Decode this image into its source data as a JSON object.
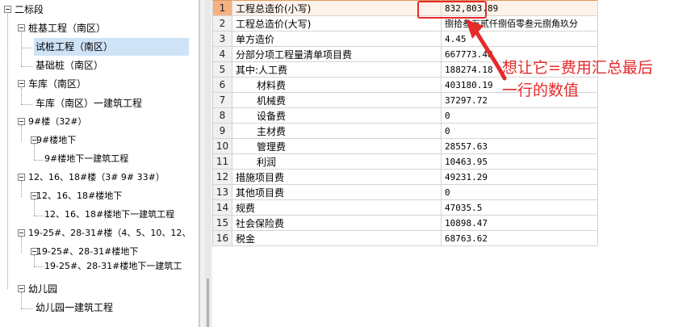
{
  "tree": {
    "items": [
      {
        "label": "二标段"
      },
      {
        "label": "桩基工程（南区）"
      },
      {
        "label": "试桩工程（南区）"
      },
      {
        "label": "基础桩（南区）"
      },
      {
        "label": "车库（南区）"
      },
      {
        "label": "车库（南区）一建筑工程"
      },
      {
        "label": "9#楼（32#）"
      },
      {
        "label": "9#楼地下"
      },
      {
        "label": "9#楼地下一建筑工程"
      },
      {
        "label": "12、16、18#楼（3# 9# 33#）"
      },
      {
        "label": "12、16、18#楼地下"
      },
      {
        "label": "12、16、18#楼地下一建筑工程"
      },
      {
        "label": "19-25#、28-31#楼（4、5、10、12、"
      },
      {
        "label": "19-25#、28-31#楼地下"
      },
      {
        "label": "19-25#、28-31#楼地下一建筑工"
      },
      {
        "label": "幼儿园"
      },
      {
        "label": "幼儿园一建筑工程"
      }
    ]
  },
  "grid": {
    "rows": [
      {
        "no": "1",
        "name": "工程总造价(小写)",
        "value": "832,803.89"
      },
      {
        "no": "2",
        "name": "工程总造价(大写)",
        "value": "捌拾叁万贰仟捌佰零叁元捌角玖分"
      },
      {
        "no": "3",
        "name": "单方造价",
        "value": "4.45"
      },
      {
        "no": "4",
        "name": "分部分项工程量清单项目费",
        "value": "667773.48"
      },
      {
        "no": "5",
        "name": "其中:人工费",
        "value": "188274.18"
      },
      {
        "no": "6",
        "name": "材料费",
        "value": "403180.19"
      },
      {
        "no": "7",
        "name": "机械费",
        "value": "37297.72"
      },
      {
        "no": "8",
        "name": "设备费",
        "value": "0"
      },
      {
        "no": "9",
        "name": "主材费",
        "value": "0"
      },
      {
        "no": "10",
        "name": "管理费",
        "value": "28557.63"
      },
      {
        "no": "11",
        "name": "利润",
        "value": "10463.95"
      },
      {
        "no": "12",
        "name": "措施项目费",
        "value": "49231.29"
      },
      {
        "no": "13",
        "name": "其他项目费",
        "value": "0"
      },
      {
        "no": "14",
        "name": "规费",
        "value": "47035.5"
      },
      {
        "no": "15",
        "name": "社会保险费",
        "value": "10898.47"
      },
      {
        "no": "16",
        "name": "税金",
        "value": "68763.62"
      }
    ]
  },
  "annotation": {
    "text": "想让它=费用汇总最后一行的数值",
    "color": "#e52a2a"
  },
  "colors": {
    "selection": "#cfe3f7",
    "highlight_row": "#f4b183",
    "annotation_red": "#e52a2a"
  }
}
